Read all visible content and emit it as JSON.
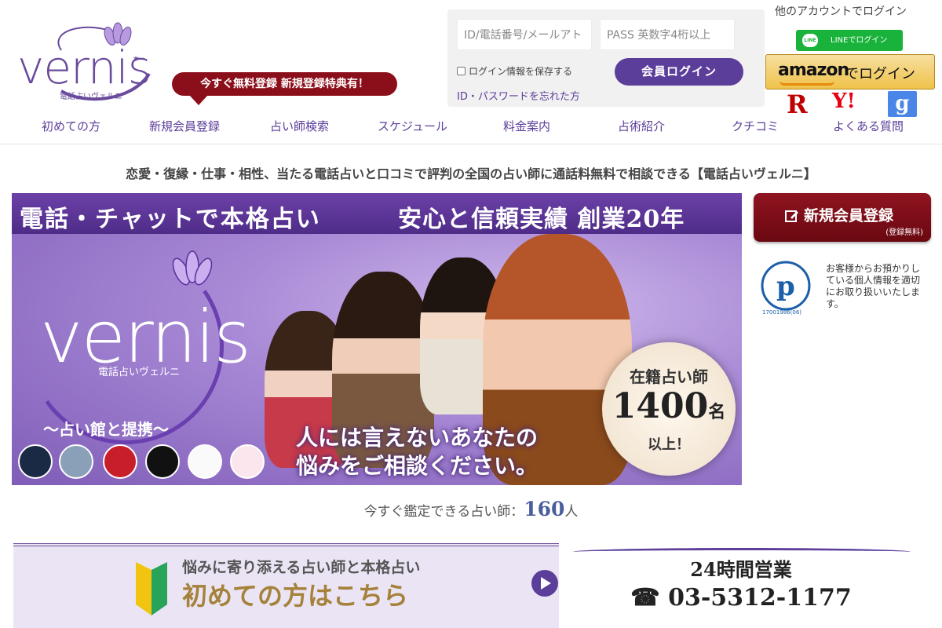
{
  "brand": {
    "name": "vernis",
    "sub": "電話占いヴェルニ",
    "purple": "#5b3d9a",
    "dark_red": "#8b0f1a"
  },
  "header": {
    "register_bubble": "今すぐ無料登録 新規登録特典有！",
    "login": {
      "id_placeholder": "ID/電話番号/メールアドレス",
      "id_visible": "ID/電話番号/メールアト",
      "pass_placeholder": "PASS 英数字4桁以上",
      "remember": "ログイン情報を保存する",
      "forgot": "ID・パスワードを忘れた方",
      "button": "会員ログイン"
    },
    "other_account": "他のアカウントでログイン",
    "sso": {
      "line": "LINEでログイン",
      "line_icon": "LINE",
      "amazon_word": "amazon",
      "amazon_text": "でログイン",
      "rakuten": "R",
      "yahoo": "Y!",
      "google": "g"
    }
  },
  "nav": [
    {
      "label": "初めての方",
      "icon": "none"
    },
    {
      "label": "新規会員登録"
    },
    {
      "label": "占い師検索"
    },
    {
      "label": "スケジュール"
    },
    {
      "label": "料金案内"
    },
    {
      "label": "占術紹介"
    },
    {
      "label": "クチコミ"
    },
    {
      "label": "よくある質問"
    }
  ],
  "headline": "恋愛・復縁・仕事・相性、当たる電話占いと口コミで評判の全国の占い師に通話料無料で相談できる【電話占いヴェルニ】",
  "hero": {
    "top_left": "電話・チャットで本格占い",
    "top_right": "安心と信頼実績 創業20年",
    "logo": "vernis",
    "logo_sub": "電話占いヴェルニ",
    "partner": "〜占い館と提携〜",
    "message_line1": "人には言えないあなたの",
    "message_line2": "悩みをご相談ください。",
    "badge_line1": "在籍占い師",
    "badge_number": "1400",
    "badge_unit": "名",
    "badge_line3": "以上！"
  },
  "sidebar": {
    "signup_label": "新規会員登録",
    "signup_note": "(登録無料)",
    "privacy_text": "お客様からお預かりしている個人情報を適切にお取り扱いいたします。",
    "privacy_number": "17001986(06)"
  },
  "availability": {
    "prefix": "今すぐ鑑定できる占い師：",
    "count": "160",
    "suffix": "人"
  },
  "beginner_banner": {
    "line1": "悩みに寄り添える占い師と本格占い",
    "line2": "初めての方はこちら"
  },
  "phone_banner": {
    "hours": "24時間営業",
    "number": "03-5312-1177",
    "icon": "telephone-icon"
  }
}
